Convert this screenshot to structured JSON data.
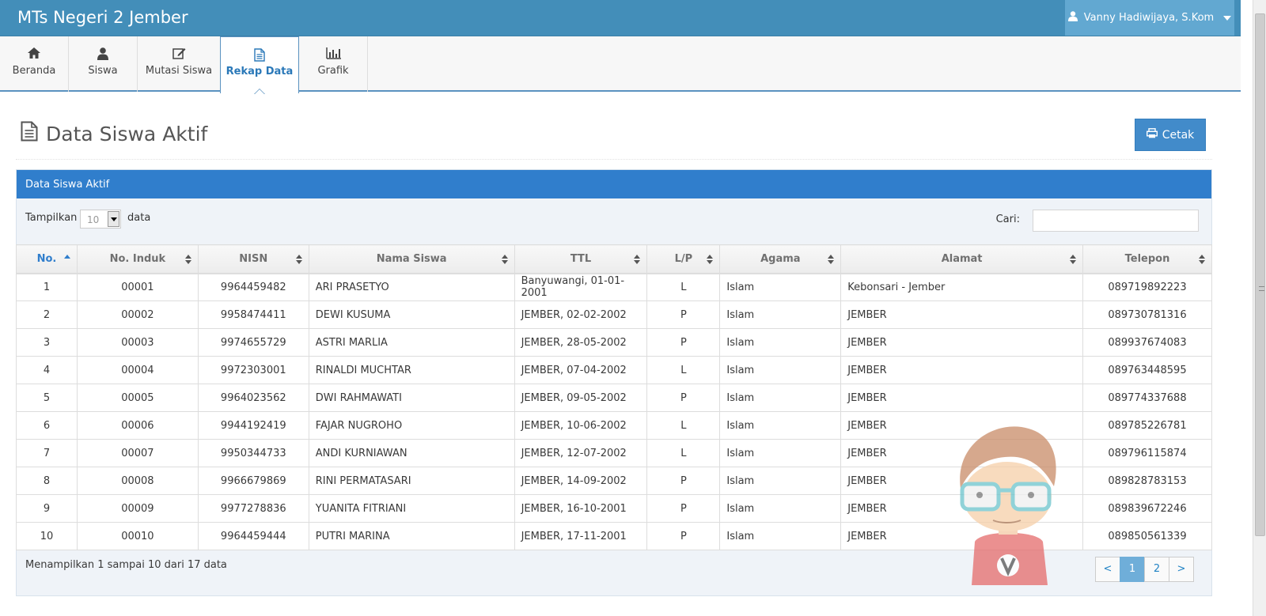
{
  "app": {
    "title": "MTs Negeri 2 Jember",
    "user_name": "Vanny Hadiwijaya, S.Kom"
  },
  "nav": [
    {
      "label": "Beranda",
      "icon": "home-icon"
    },
    {
      "label": "Siswa",
      "icon": "user-icon"
    },
    {
      "label": "Mutasi Siswa",
      "icon": "edit-icon"
    },
    {
      "label": "Rekap Data",
      "icon": "file-icon",
      "active": true
    },
    {
      "label": "Grafik",
      "icon": "bar-chart-icon"
    }
  ],
  "page": {
    "title": "Data Siswa Aktif",
    "print_label": "Cetak"
  },
  "panel": {
    "heading": "Data Siswa Aktif",
    "show_label": "Tampilkan",
    "page_size": "10",
    "data_label": "data",
    "search_label": "Cari:",
    "search_value": "",
    "info": "Menampilkan 1 sampai 10 dari 17 data"
  },
  "table": {
    "columns": [
      "No.",
      "No. Induk",
      "NISN",
      "Nama Siswa",
      "TTL",
      "L/P",
      "Agama",
      "Alamat",
      "Telepon"
    ],
    "rows": [
      [
        "1",
        "00001",
        "9964459482",
        "ARI PRASETYO",
        "Banyuwangi, 01-01-2001",
        "L",
        "Islam",
        "Kebonsari - Jember",
        "089719892223"
      ],
      [
        "2",
        "00002",
        "9958474411",
        "DEWI KUSUMA",
        "JEMBER, 02-02-2002",
        "P",
        "Islam",
        "JEMBER",
        "089730781316"
      ],
      [
        "3",
        "00003",
        "9974655729",
        "ASTRI MARLIA",
        "JEMBER, 28-05-2002",
        "P",
        "Islam",
        "JEMBER",
        "089937674083"
      ],
      [
        "4",
        "00004",
        "9972303001",
        "RINALDI MUCHTAR",
        "JEMBER, 07-04-2002",
        "L",
        "Islam",
        "JEMBER",
        "089763448595"
      ],
      [
        "5",
        "00005",
        "9964023562",
        "DWI RAHMAWATI",
        "JEMBER, 09-05-2002",
        "P",
        "Islam",
        "JEMBER",
        "089774337688"
      ],
      [
        "6",
        "00006",
        "9944192419",
        "FAJAR NUGROHO",
        "JEMBER, 10-06-2002",
        "L",
        "Islam",
        "JEMBER",
        "089785226781"
      ],
      [
        "7",
        "00007",
        "9950344733",
        "ANDI KURNIAWAN",
        "JEMBER, 12-07-2002",
        "L",
        "Islam",
        "JEMBER",
        "089796115874"
      ],
      [
        "8",
        "00008",
        "9966679869",
        "RINI PERMATASARI",
        "JEMBER, 14-09-2002",
        "P",
        "Islam",
        "JEMBER",
        "089828783153"
      ],
      [
        "9",
        "00009",
        "9977278836",
        "YUANITA FITRIANI",
        "JEMBER, 16-10-2001",
        "P",
        "Islam",
        "JEMBER",
        "089839672246"
      ],
      [
        "10",
        "00010",
        "9964459444",
        "PUTRI MARINA",
        "JEMBER, 17-11-2001",
        "P",
        "Islam",
        "JEMBER",
        "089850561339"
      ]
    ]
  },
  "pagination": {
    "prev": "<",
    "pages": [
      "1",
      "2"
    ],
    "current": "1",
    "next": ">"
  },
  "colors": {
    "topbar": "#438eb9",
    "panel_heading": "#307ecc",
    "accent": "#428bca"
  }
}
